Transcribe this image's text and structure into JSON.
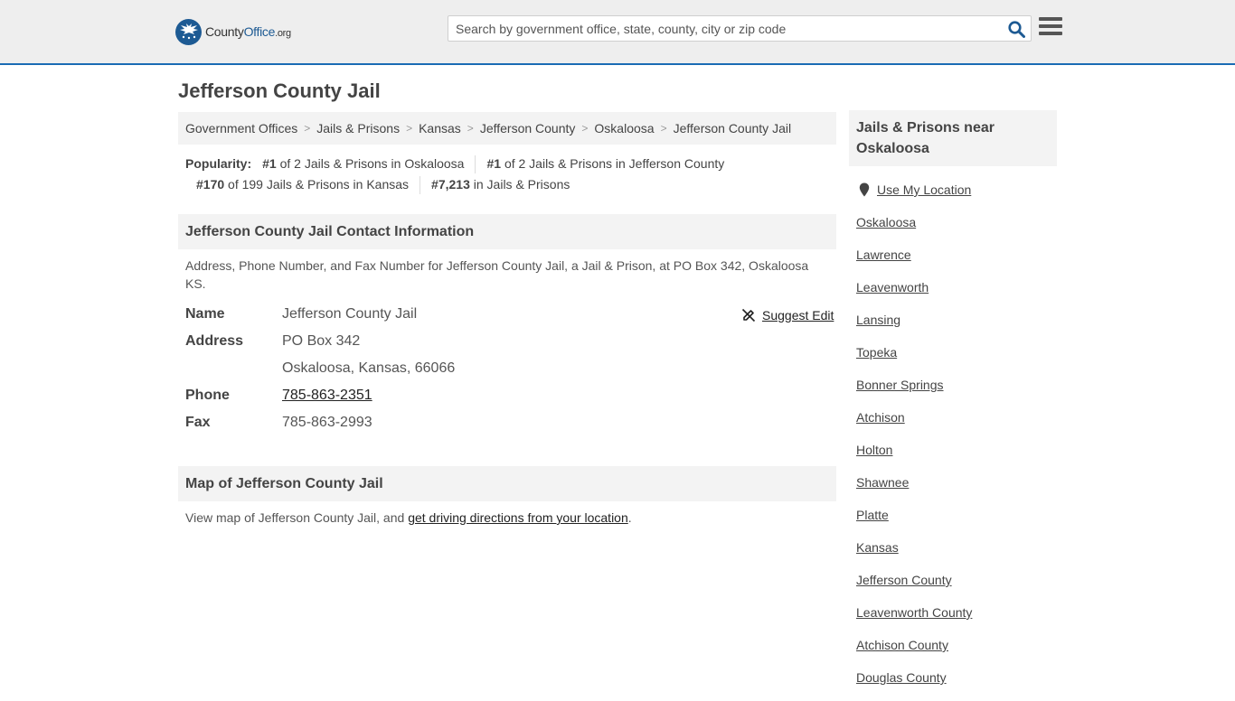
{
  "header": {
    "logo_part1": "County",
    "logo_part2": "Office",
    "logo_part3": ".org",
    "search_placeholder": "Search by government office, state, county, city or zip code",
    "brand_color": "#1d5a93"
  },
  "page": {
    "title": "Jefferson County Jail"
  },
  "breadcrumb": [
    "Government Offices",
    "Jails & Prisons",
    "Kansas",
    "Jefferson County",
    "Oskaloosa",
    "Jefferson County Jail"
  ],
  "popularity": {
    "label": "Popularity:",
    "items": [
      {
        "rank": "#1",
        "text": "of 2 Jails & Prisons in Oskaloosa"
      },
      {
        "rank": "#1",
        "text": "of 2 Jails & Prisons in Jefferson County"
      },
      {
        "rank": "#170",
        "text": "of 199 Jails & Prisons in Kansas"
      },
      {
        "rank": "#7,213",
        "text": "in Jails & Prisons"
      }
    ]
  },
  "contact": {
    "heading": "Jefferson County Jail Contact Information",
    "description": "Address, Phone Number, and Fax Number for Jefferson County Jail, a Jail & Prison, at PO Box 342, Oskaloosa KS.",
    "suggest_edit": "Suggest Edit",
    "name_label": "Name",
    "name": "Jefferson County Jail",
    "address_label": "Address",
    "address_line1": "PO Box 342",
    "address_line2": "Oskaloosa, Kansas, 66066",
    "phone_label": "Phone",
    "phone": "785-863-2351",
    "fax_label": "Fax",
    "fax": "785-863-2993"
  },
  "map": {
    "heading": "Map of Jefferson County Jail",
    "desc_prefix": "View map of Jefferson County Jail, and ",
    "desc_link": "get driving directions from your location",
    "desc_suffix": "."
  },
  "sidebar": {
    "heading": "Jails & Prisons near Oskaloosa",
    "use_location": "Use My Location",
    "links": [
      "Oskaloosa",
      "Lawrence",
      "Leavenworth",
      "Lansing",
      "Topeka",
      "Bonner Springs",
      "Atchison",
      "Holton",
      "Shawnee",
      "Platte",
      "Kansas",
      "Jefferson County",
      "Leavenworth County",
      "Atchison County",
      "Douglas County"
    ]
  }
}
